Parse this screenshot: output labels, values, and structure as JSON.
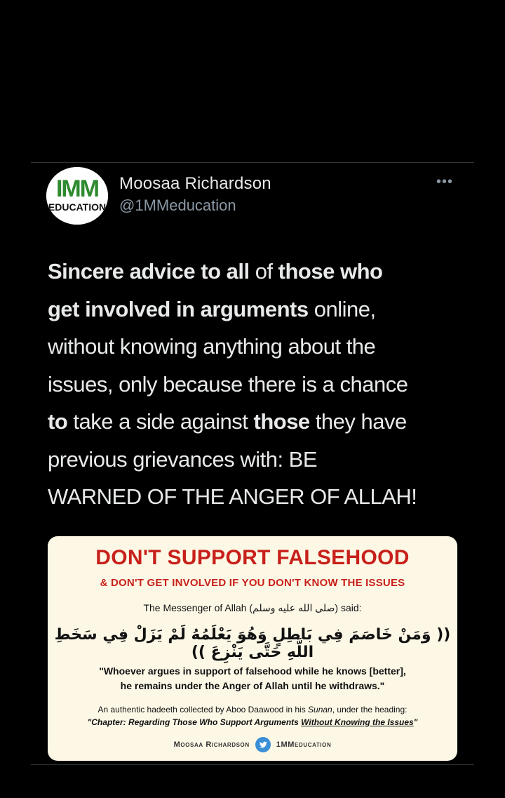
{
  "author": {
    "name": "Moosaa Richardson",
    "handle": "@1MMeducation",
    "avatar_text_top": "IMM",
    "avatar_text_bottom": "EDUCATION"
  },
  "more_icon": "more-horizontal-icon",
  "tweet_lines": [
    [
      {
        "t": "Sincere advice to all ",
        "b": true
      },
      {
        "t": "of ",
        "b": false
      },
      {
        "t": "those who",
        "b": true
      }
    ],
    [
      {
        "t": "get involved in arguments",
        "b": true
      },
      {
        "t": " online,",
        "b": false
      }
    ],
    [
      {
        "t": "without knowing anything about the",
        "b": false
      }
    ],
    [
      {
        "t": "issues, only because there is a chance",
        "b": false
      }
    ],
    [
      {
        "t": "to",
        "b": true
      },
      {
        "t": " take a side against ",
        "b": false
      },
      {
        "t": "those",
        "b": true
      },
      {
        "t": " they have",
        "b": false
      }
    ],
    [
      {
        "t": "previous grievances with: BE",
        "b": false
      }
    ],
    [
      {
        "t": "WARNED OF THE ANGER OF ALLAH!",
        "b": false
      }
    ]
  ],
  "card": {
    "title": "DON'T SUPPORT FALSEHOOD",
    "subtitle": "& DON'T GET INVOLVED IF YOU DON'T KNOW THE ISSUES",
    "said": "The Messenger of Allah (صلى الله عليه وسلم) said:",
    "arabic": "(( وَمَنْ خَاصَمَ فِي بَاطِلٍ وَهُوَ يَعْلَمُهُ لَمْ يَزَلْ فِي سَخَطِ اللَّهِ حَتَّى يَنْزِعَ ))",
    "translation_1": "\"Whoever argues in support of falsehood while he knows [better],",
    "translation_2": "he remains under the Anger of Allah until he withdraws.\"",
    "note_1a": "An authentic hadeeth collected by Aboo Daawood in his ",
    "note_1b": "Sunan",
    "note_1c": ", under the heading:",
    "note_2a": "\"Chapter: Regarding Those Who Support Arguments ",
    "note_2b": "Without Knowing the Issues",
    "note_2c": "\"",
    "footer_left": "Moosaa Richardson",
    "footer_right": "1MMeducation",
    "footer_icon": "twitter-bird-icon"
  },
  "colors": {
    "background": "#000000",
    "text": "#e7e9ea",
    "secondary": "#8b98a5",
    "card_bg": "#fdf8e6",
    "accent_red": "#c8201b",
    "avatar_green": "#2d8a2f"
  }
}
